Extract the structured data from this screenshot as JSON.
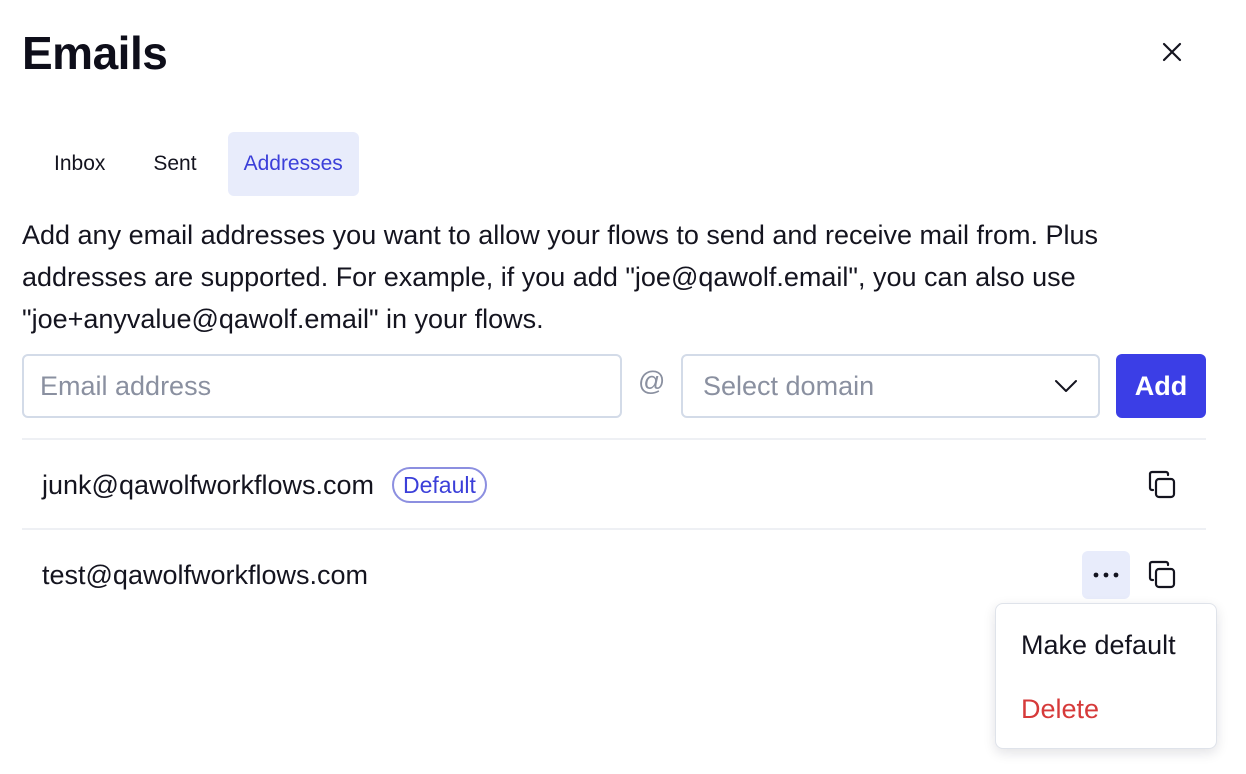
{
  "dialog": {
    "title": "Emails"
  },
  "tabs": [
    {
      "label": "Inbox",
      "active": false
    },
    {
      "label": "Sent",
      "active": false
    },
    {
      "label": "Addresses",
      "active": true
    }
  ],
  "description": "Add any email addresses you want to allow your flows to send and receive mail from. Plus addresses are supported. For example, if you add \"joe@qawolf.email\", you can also use \"joe+anyvalue@qawolf.email\" in your flows.",
  "form": {
    "email_placeholder": "Email address",
    "email_value": "",
    "at_sign": "@",
    "domain_placeholder": "Select domain",
    "add_label": "Add"
  },
  "addresses": [
    {
      "email": "junk@qawolfworkflows.com",
      "badge": "Default"
    },
    {
      "email": "test@qawolfworkflows.com",
      "badge": ""
    }
  ],
  "context_menu": {
    "make_default_label": "Make default",
    "delete_label": "Delete"
  },
  "colors": {
    "accent": "#3b3ee6",
    "active_tab_bg": "#e8ecfb",
    "danger": "#d63a3a"
  },
  "icons": {
    "close": "close-icon",
    "dropdown": "chevron-down-icon",
    "copy": "copy-icon",
    "more": "more-horizontal-icon"
  }
}
